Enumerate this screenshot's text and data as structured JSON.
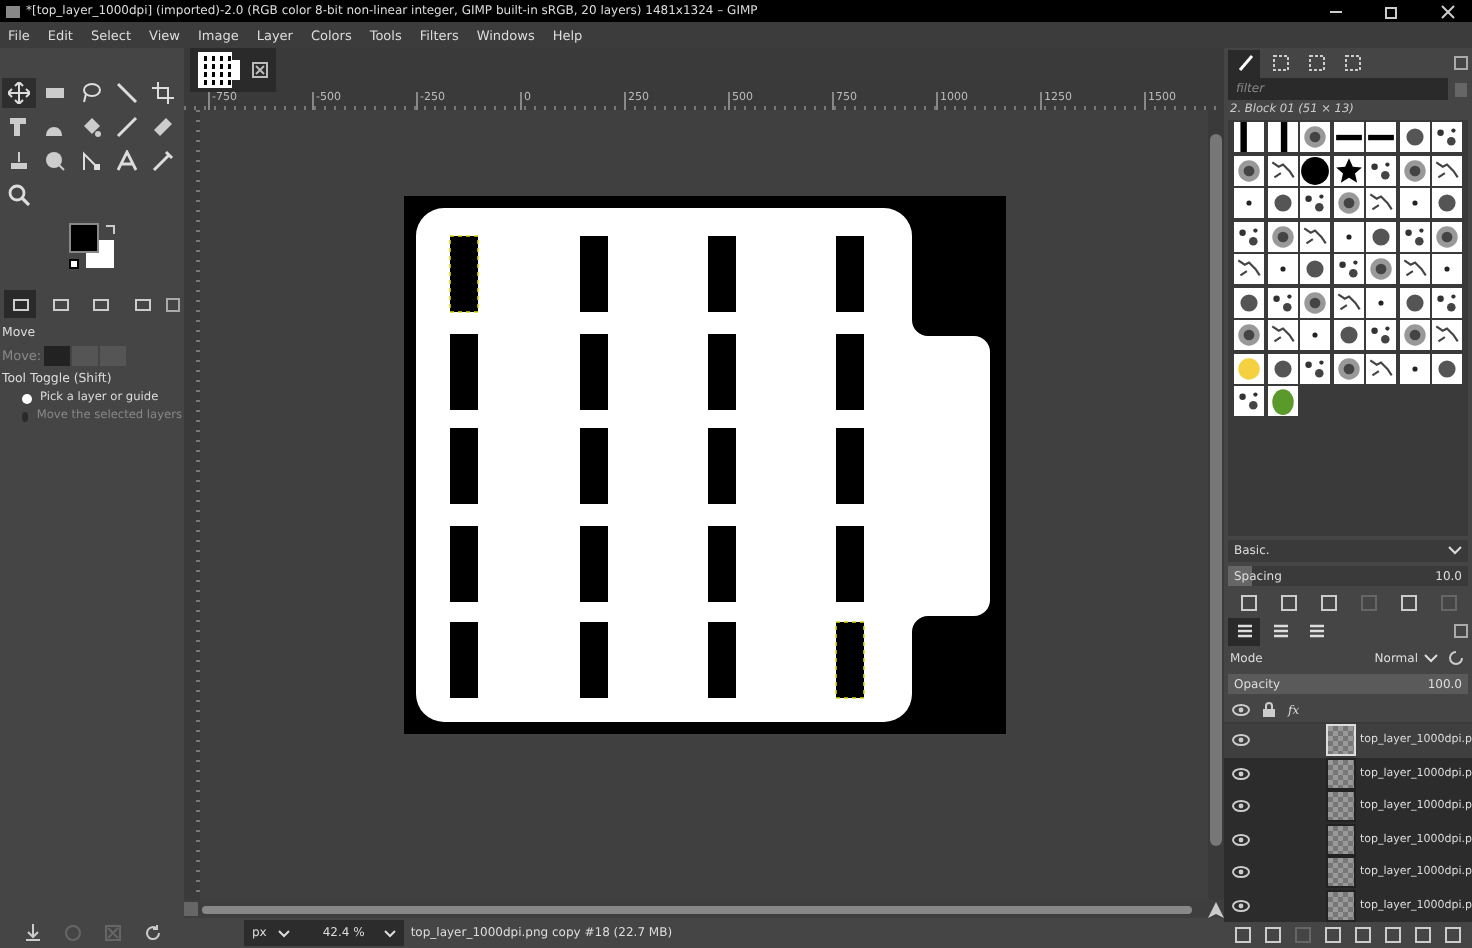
{
  "window": {
    "title": "*[top_layer_1000dpi] (imported)-2.0 (RGB color 8-bit non-linear integer, GIMP built-in sRGB, 20 layers) 1481x1324 – GIMP"
  },
  "menu": [
    "File",
    "Edit",
    "Select",
    "View",
    "Image",
    "Layer",
    "Colors",
    "Tools",
    "Filters",
    "Windows",
    "Help"
  ],
  "toolbox": {
    "tools": [
      {
        "selected": true
      },
      {
        "selected": false
      },
      {
        "selected": false
      },
      {
        "selected": false
      },
      {
        "selected": false
      },
      {
        "selected": false
      },
      {
        "selected": false
      },
      {
        "selected": false
      },
      {
        "selected": false
      },
      {
        "selected": false
      },
      {
        "selected": false
      },
      {
        "selected": false
      },
      {
        "selected": false
      },
      {
        "selected": false
      },
      {
        "selected": false
      },
      {
        "selected": false
      }
    ]
  },
  "tool_options": {
    "dock_tabs": [
      {
        "selected": true
      },
      {
        "selected": false
      },
      {
        "selected": false
      },
      {
        "selected": false
      }
    ],
    "title": "Move",
    "move_label": "Move:",
    "modes": [
      {
        "selected": true
      },
      {
        "selected": false
      },
      {
        "selected": false
      }
    ],
    "toggle_label": "Tool Toggle  (Shift)",
    "options": [
      {
        "label": "Pick a layer or guide",
        "selected": true
      },
      {
        "label": "Move the selected layers",
        "selected": false
      }
    ]
  },
  "ruler": {
    "labels": [
      "-750",
      "-500",
      "-250",
      "0",
      "250",
      "500",
      "750",
      "1000",
      "1250",
      "1500"
    ]
  },
  "brushes": {
    "dock_tabs": [
      {
        "selected": true
      },
      {
        "selected": false
      },
      {
        "selected": false
      },
      {
        "selected": false
      }
    ],
    "filter_placeholder": "filter",
    "brush_name": "2. Block 01 (51 × 13)",
    "preset": "Basic.",
    "spacing_label": "Spacing",
    "spacing_value": "10.0",
    "level": 0.1
  },
  "layers": {
    "dock_tabs": [
      {
        "selected": true
      },
      {
        "selected": false
      },
      {
        "selected": false
      }
    ],
    "effects_label": "fx",
    "mode_label": "Mode",
    "mode_value": "Normal",
    "opacity_label": "Opacity",
    "opacity_value": "100.0",
    "level": 1,
    "items": [
      {
        "name": "top_layer_1000dpi.p",
        "selected": true,
        "visible": true
      },
      {
        "name": "top_layer_1000dpi.p",
        "selected": false,
        "visible": true
      },
      {
        "name": "top_layer_1000dpi.p",
        "selected": false,
        "visible": true
      },
      {
        "name": "top_layer_1000dpi.p",
        "selected": false,
        "visible": true
      },
      {
        "name": "top_layer_1000dpi.p",
        "selected": false,
        "visible": true
      },
      {
        "name": "top_layer_1000dpi.p",
        "selected": false,
        "visible": true
      }
    ]
  },
  "status": {
    "unit": "px",
    "zoom": "42.4 %",
    "info": "top_layer_1000dpi.png copy #18 (22.7 MB)"
  }
}
